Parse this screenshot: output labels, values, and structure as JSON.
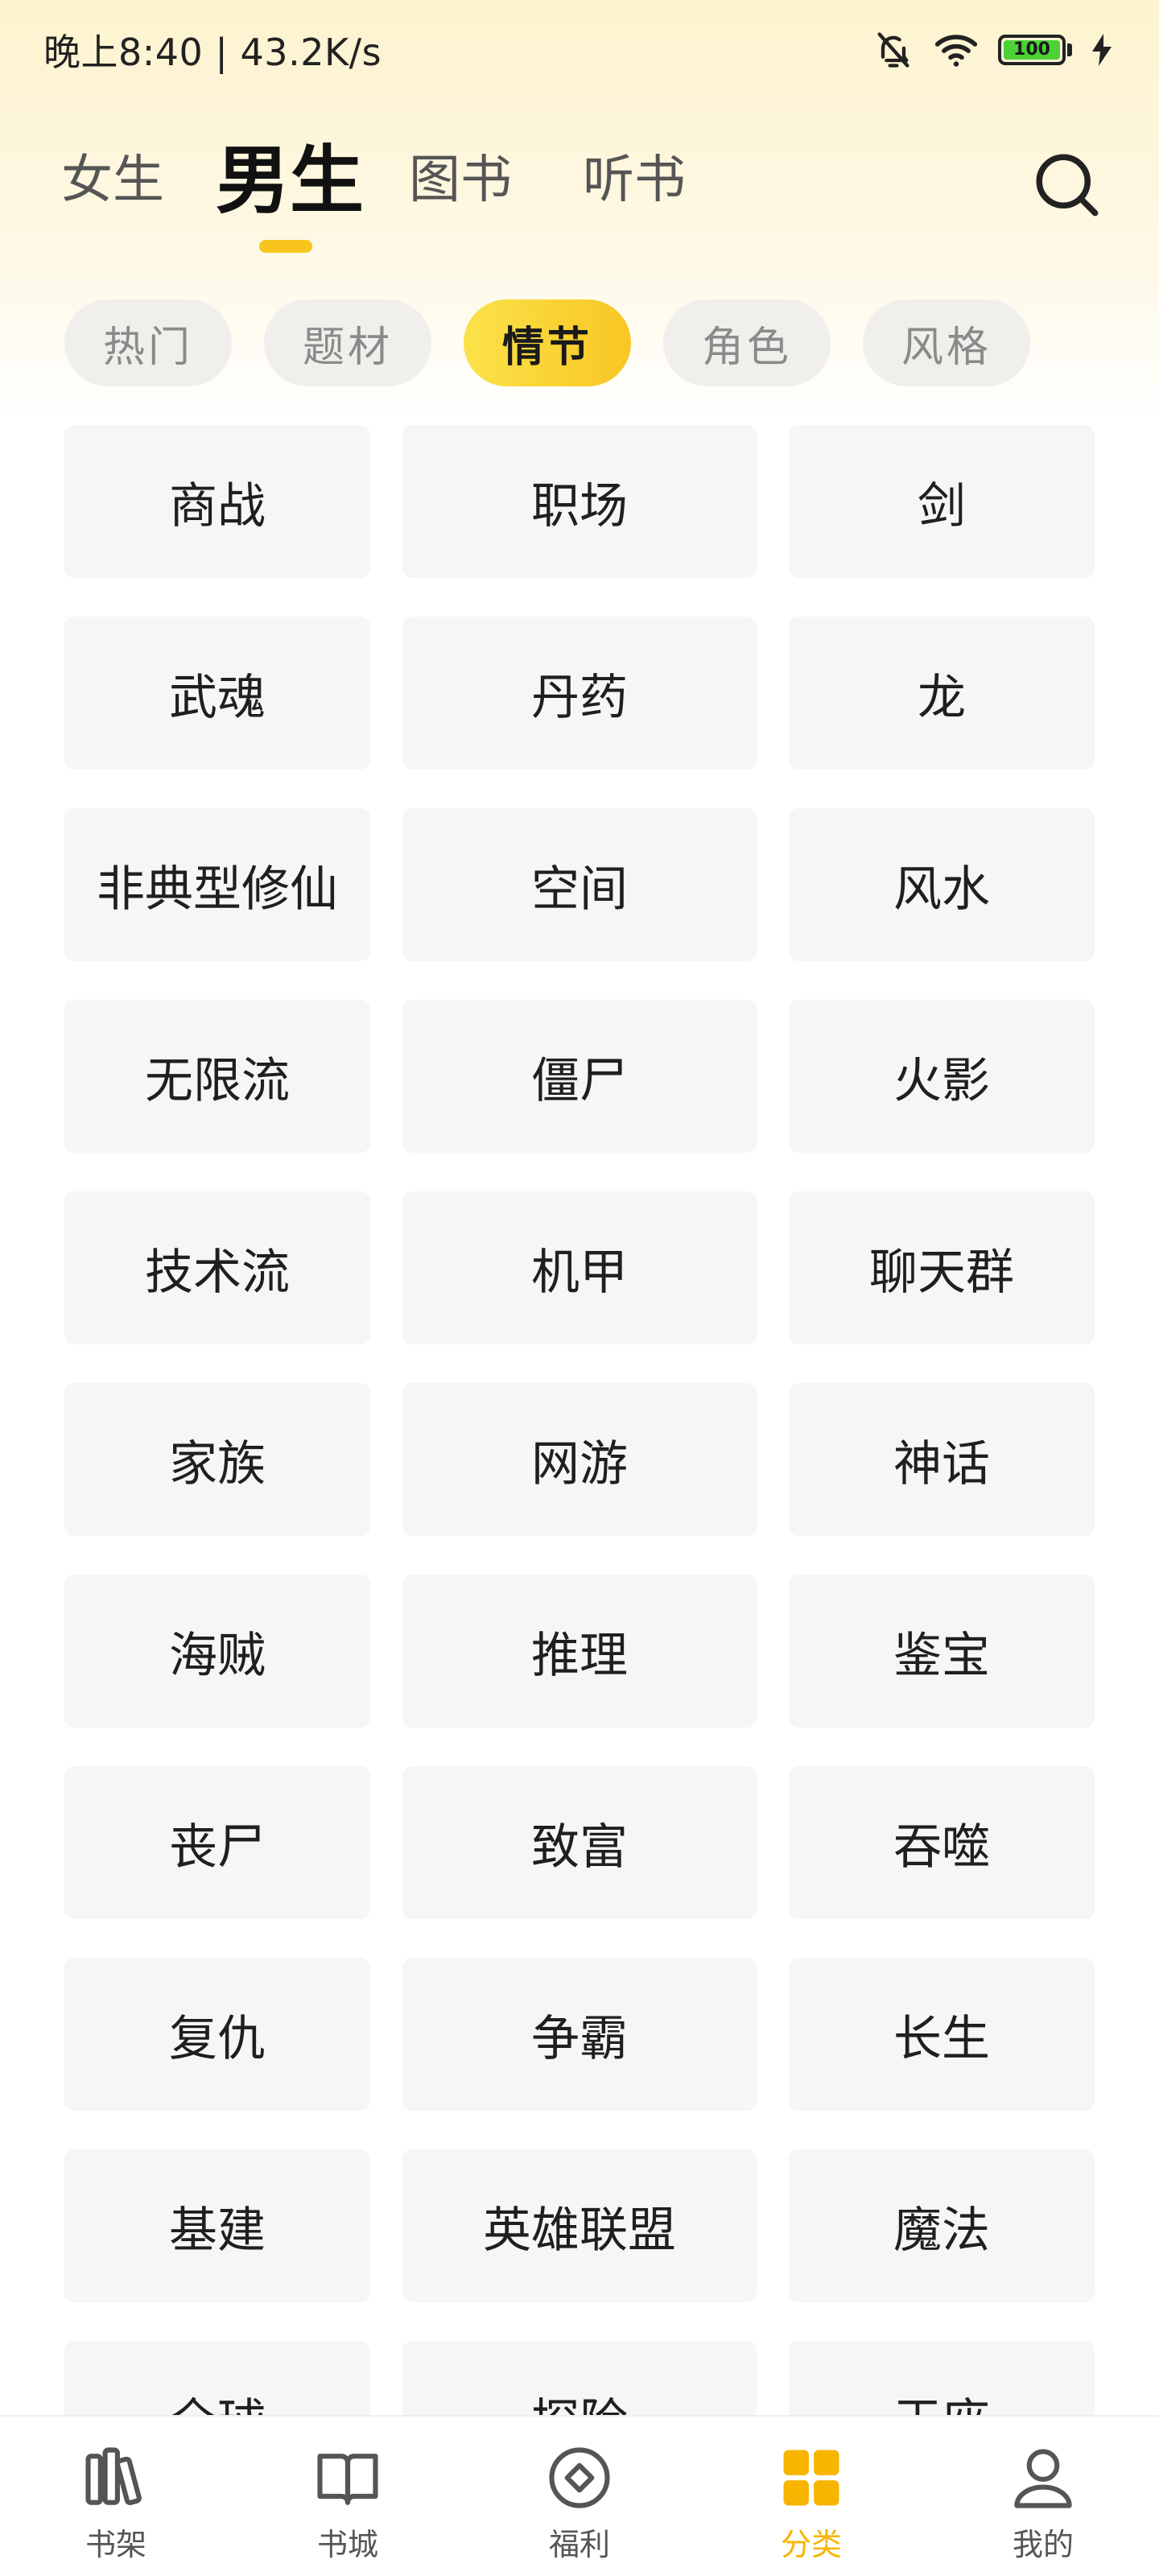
{
  "status_bar": {
    "time_speed": "晚上8:40 | 43.2K/s",
    "battery": "100"
  },
  "header": {
    "tabs": [
      {
        "label": "女生",
        "active": false
      },
      {
        "label": "男生",
        "active": true
      },
      {
        "label": "图书",
        "active": false
      },
      {
        "label": "听书",
        "active": false
      }
    ]
  },
  "subtabs": [
    {
      "label": "热门",
      "active": false
    },
    {
      "label": "题材",
      "active": false
    },
    {
      "label": "情节",
      "active": true
    },
    {
      "label": "角色",
      "active": false
    },
    {
      "label": "风格",
      "active": false
    }
  ],
  "categories": [
    "商战",
    "职场",
    "剑",
    "武魂",
    "丹药",
    "龙",
    "非典型修仙",
    "空间",
    "风水",
    "无限流",
    "僵尸",
    "火影",
    "技术流",
    "机甲",
    "聊天群",
    "家族",
    "网游",
    "神话",
    "海贼",
    "推理",
    "鉴宝",
    "丧尸",
    "致富",
    "吞噬",
    "复仇",
    "争霸",
    "长生",
    "基建",
    "英雄联盟",
    "魔法",
    "全球",
    "探险",
    "王座"
  ],
  "bottom_nav": [
    {
      "label": "书架",
      "icon": "bookshelf-icon",
      "active": false
    },
    {
      "label": "书城",
      "icon": "open-book-icon",
      "active": false
    },
    {
      "label": "福利",
      "icon": "diamond-coin-icon",
      "active": false
    },
    {
      "label": "分类",
      "icon": "grid-category-icon",
      "active": true
    },
    {
      "label": "我的",
      "icon": "person-icon",
      "active": false
    }
  ],
  "colors": {
    "accent": "#f7c51d",
    "nav_active": "#f7b500",
    "tile_bg": "#f6f6f7",
    "pill_bg": "#f0efeb"
  }
}
